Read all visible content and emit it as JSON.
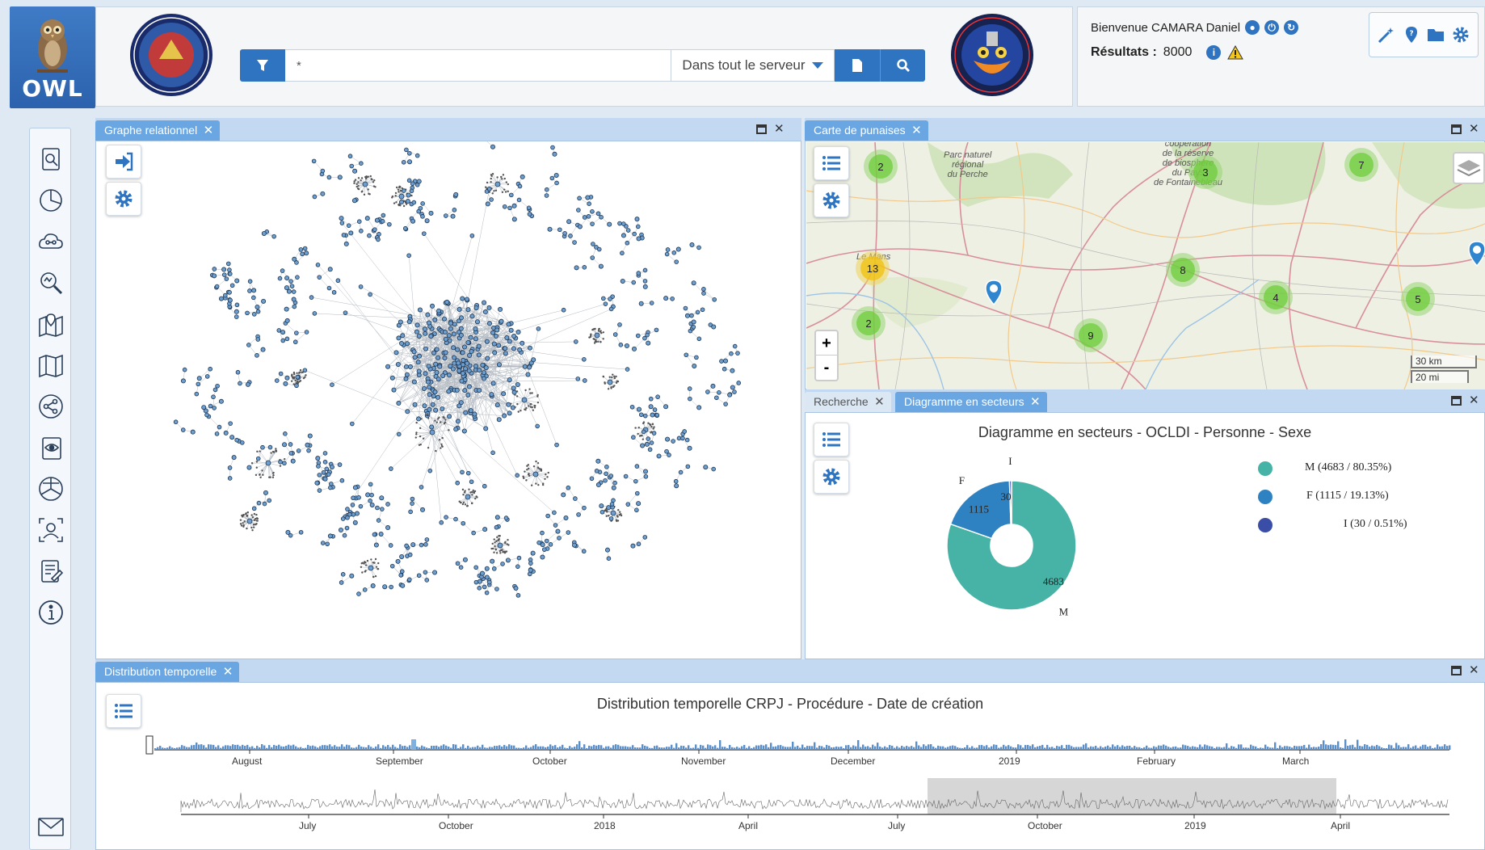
{
  "app": {
    "logo_text": "OWL"
  },
  "search": {
    "query": "*",
    "scope": "Dans tout le serveur"
  },
  "user": {
    "welcome": "Bienvenue CAMARA Daniel",
    "results_label": "Résultats :",
    "results_count": "8000"
  },
  "sidebar": {
    "items": [
      "search-doc-icon",
      "chart-pie-icon",
      "cloud-share-icon",
      "zoom-search-icon",
      "map-pin-icon",
      "map-icon",
      "share-nodes-icon",
      "eye-doc-icon",
      "network-circle-icon",
      "user-focus-icon",
      "edit-doc-icon",
      "info-icon"
    ],
    "mail_icon": "mail-icon"
  },
  "panels": {
    "graph": {
      "tab": "Graphe relationnel"
    },
    "map": {
      "tab": "Carte de punaises",
      "clusters": [
        {
          "label": "2",
          "color": "green"
        },
        {
          "label": "3",
          "color": "green"
        },
        {
          "label": "7",
          "color": "green"
        },
        {
          "label": "13",
          "color": "yellow"
        },
        {
          "label": "8",
          "color": "green"
        },
        {
          "label": "4",
          "color": "green"
        },
        {
          "label": "5",
          "color": "green"
        },
        {
          "label": "2",
          "color": "green"
        },
        {
          "label": "9",
          "color": "green"
        }
      ],
      "labels": {
        "perche": "Parc naturel\nrégional\ndu Perche",
        "fontainebleau": "de la réserve\nde biosphère\ndu Pays\nde Fontainebleau",
        "cooperation": "coopération",
        "lemans": "Le Mans"
      },
      "zoom_in": "+",
      "zoom_out": "-",
      "scale_km": "30 km",
      "scale_mi": "20 mi"
    },
    "tabs_bottom_right": {
      "tab1": "Recherche",
      "tab2": "Diagramme en secteurs"
    },
    "pie": {
      "title": "Diagramme en secteurs - OCLDI - Personne - Sexe",
      "legend": [
        "M (4683 / 80.35%)",
        "F (1115 / 19.13%)",
        "I (30 / 0.51%)"
      ],
      "slice_labels": {
        "M_value": "4683",
        "F_value": "1115",
        "I_value": "30",
        "M": "M",
        "F": "F",
        "I": "I"
      }
    },
    "timeline": {
      "tab": "Distribution temporelle",
      "title": "Distribution temporelle CRPJ - Procédure - Date de création",
      "top_axis": [
        "August",
        "September",
        "October",
        "November",
        "December",
        "2019",
        "February",
        "March"
      ],
      "bottom_axis": [
        "July",
        "October",
        "2018",
        "April",
        "July",
        "October",
        "2019",
        "April"
      ]
    }
  },
  "chart_data": {
    "type": "pie",
    "title": "Diagramme en secteurs - OCLDI - Personne - Sexe",
    "categories": [
      "M",
      "F",
      "I"
    ],
    "values": [
      4683,
      1115,
      30
    ],
    "percentages": [
      80.35,
      19.13,
      0.51
    ],
    "colors": [
      "#46b3a6",
      "#2f82c2",
      "#3a4ea8"
    ],
    "donut": true
  }
}
